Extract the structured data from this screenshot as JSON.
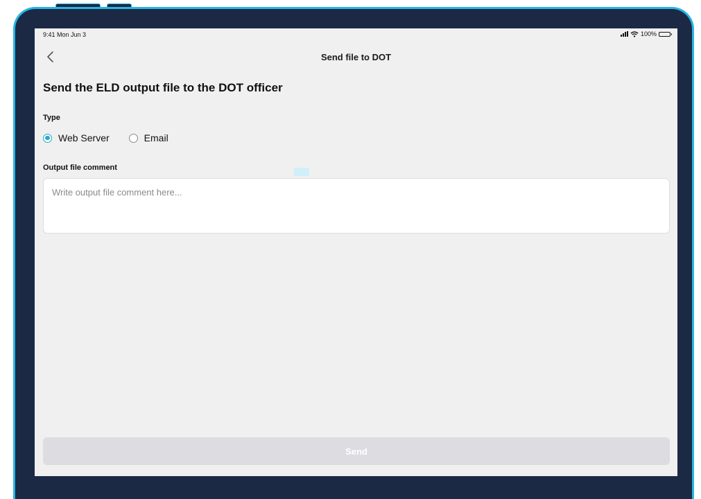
{
  "status_bar": {
    "time": "9:41 Mon Jun 3",
    "battery": "100%",
    "icons": [
      "signal-icon",
      "wifi-icon",
      "battery-icon"
    ]
  },
  "nav": {
    "title": "Send file to DOT",
    "back_icon": "chevron-left-icon"
  },
  "page": {
    "heading": "Send the ELD output file to the DOT officer"
  },
  "type": {
    "label": "Type",
    "options": [
      {
        "label": "Web Server",
        "selected": true
      },
      {
        "label": "Email",
        "selected": false
      }
    ]
  },
  "comment": {
    "label": "Output file comment",
    "value": "",
    "placeholder": "Write output file comment here..."
  },
  "send": {
    "label": "Send",
    "disabled": true
  },
  "colors": {
    "accent": "#27a9c7",
    "frame": "#1b2945",
    "frame_border": "#27b5e4",
    "screen_bg": "#f0f0f0",
    "button_disabled": "#dcdce1"
  }
}
